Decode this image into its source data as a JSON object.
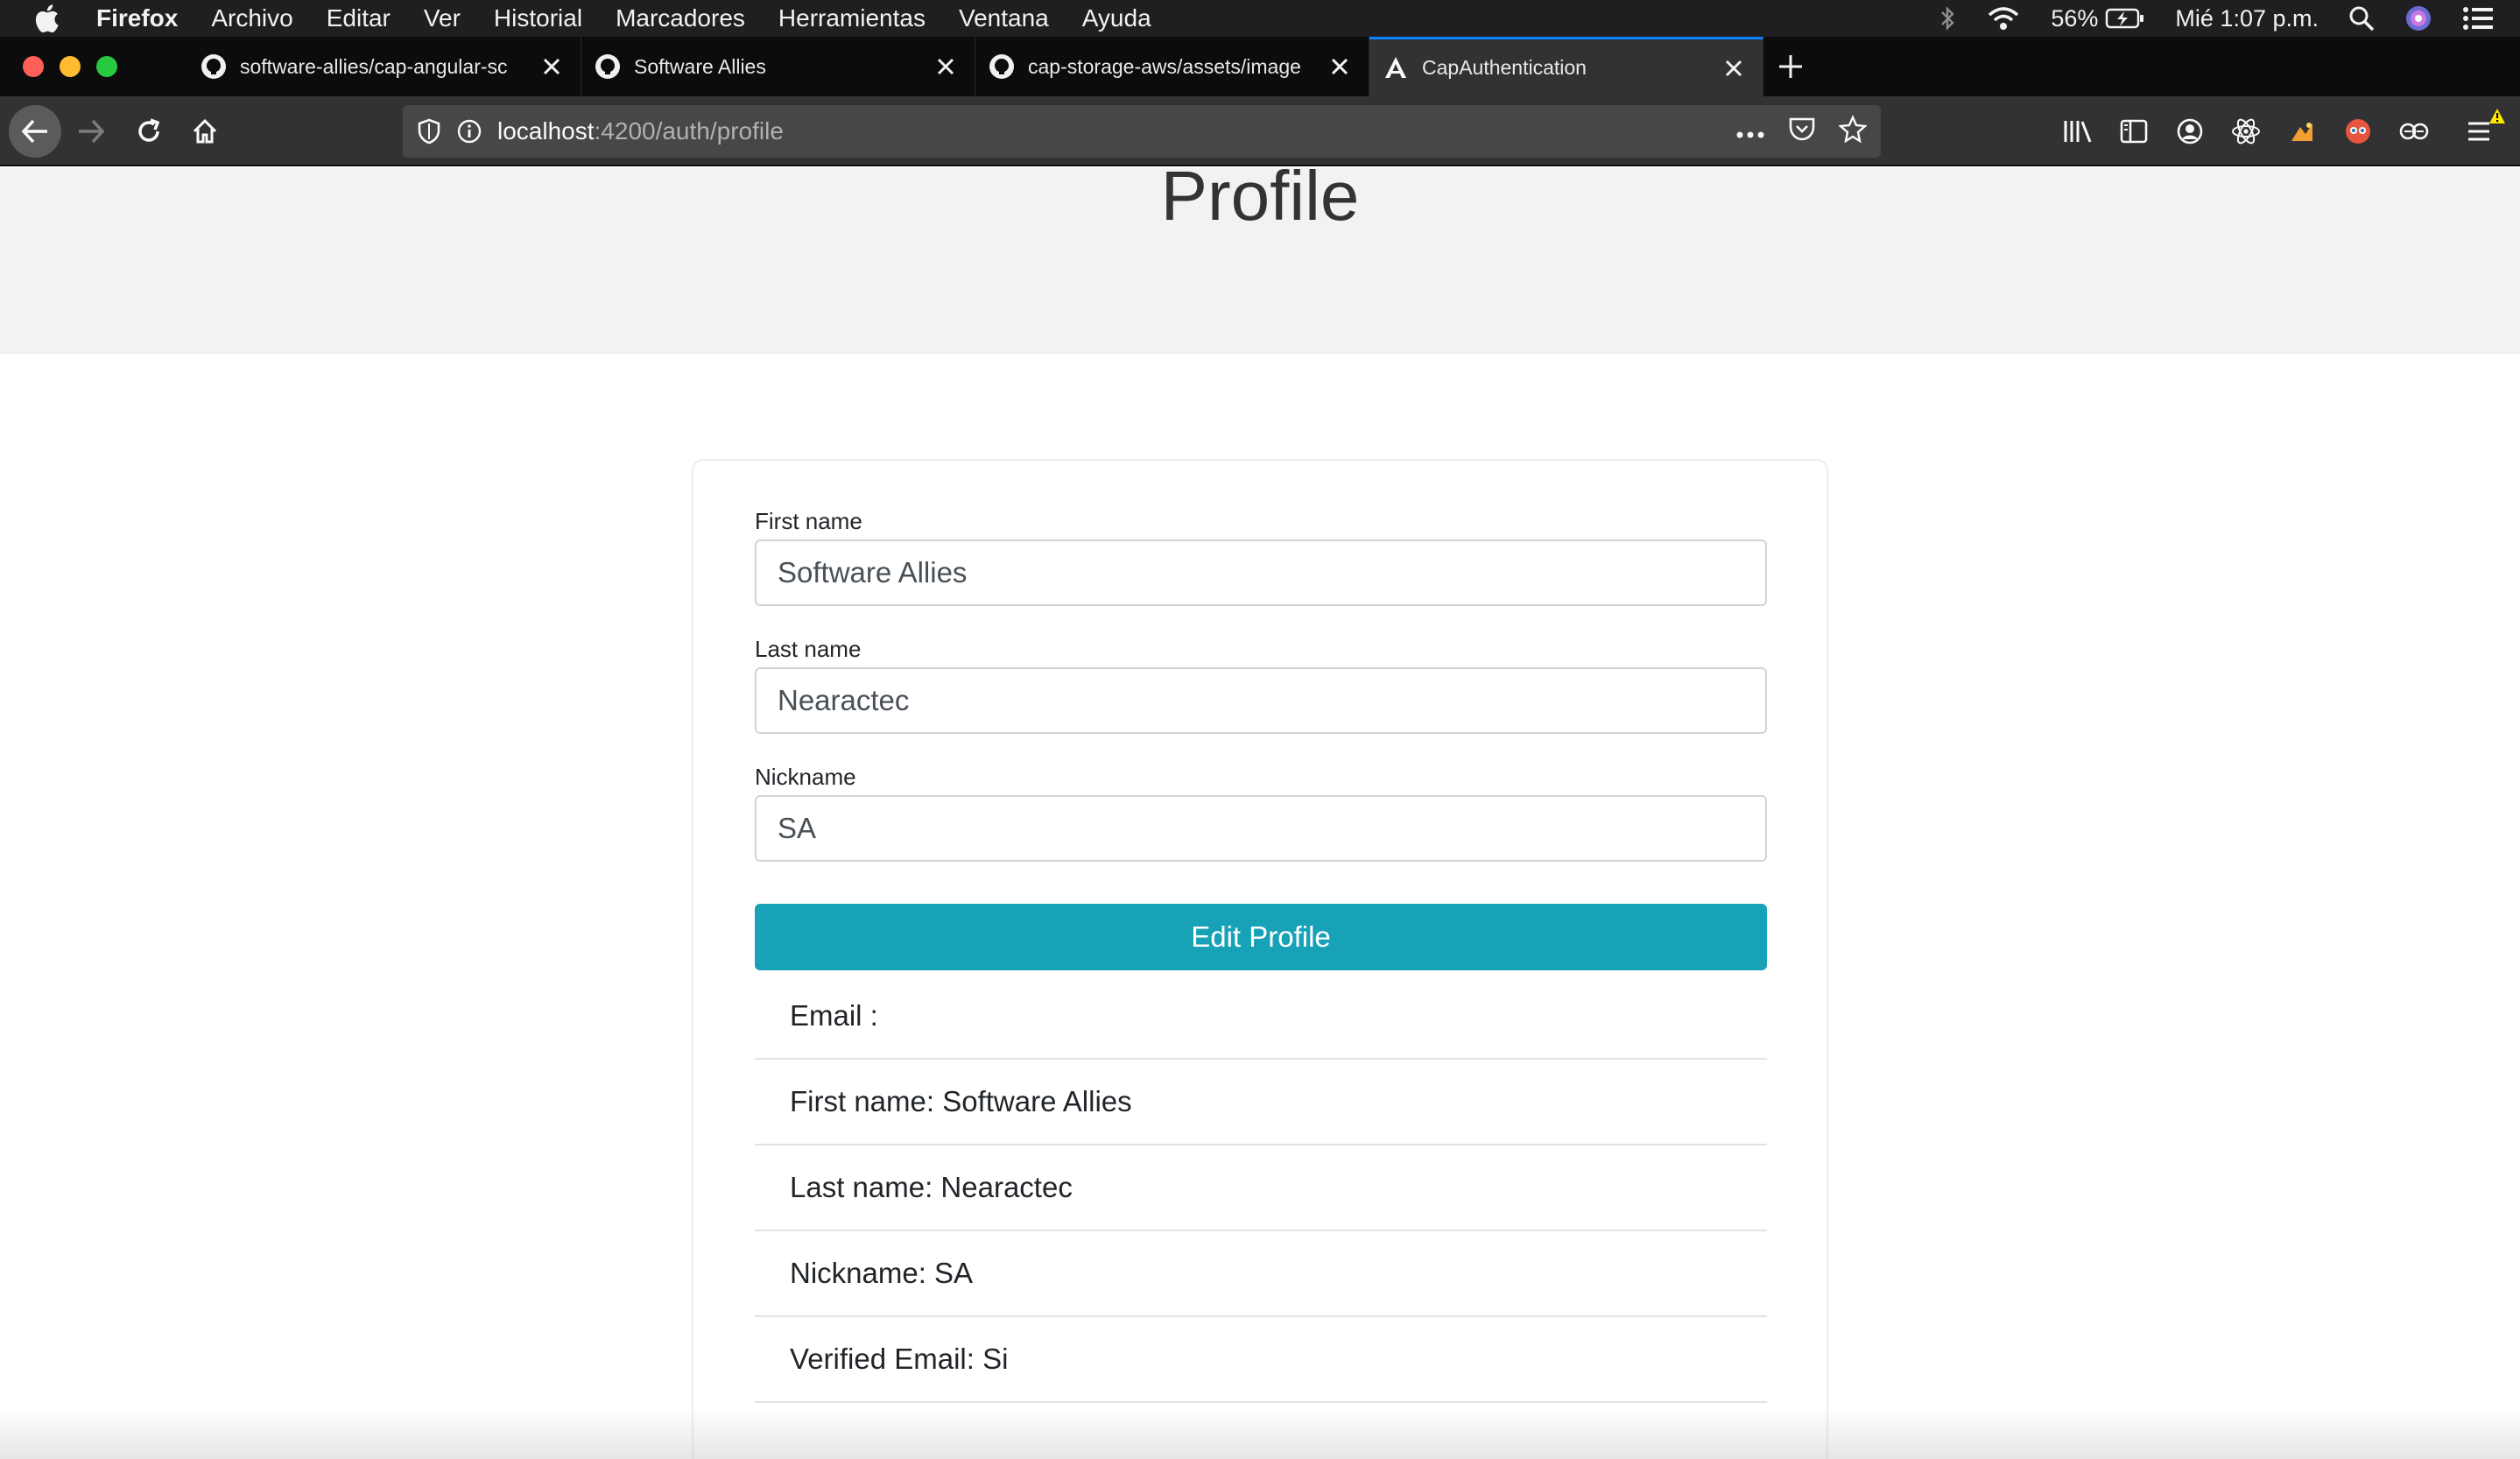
{
  "menubar": {
    "app_name": "Firefox",
    "items": [
      "Archivo",
      "Editar",
      "Ver",
      "Historial",
      "Marcadores",
      "Herramientas",
      "Ventana",
      "Ayuda"
    ],
    "battery": "56%",
    "clock": "Mié 1:07 p.m."
  },
  "tabs": [
    {
      "title": "software-allies/cap-angular-sc",
      "favicon": "github-icon",
      "active": false
    },
    {
      "title": "Software Allies",
      "favicon": "github-icon",
      "active": false
    },
    {
      "title": "cap-storage-aws/assets/image",
      "favicon": "github-icon",
      "active": false
    },
    {
      "title": "CapAuthentication",
      "favicon": "angular-icon",
      "active": true
    }
  ],
  "navbar": {
    "url_host": "localhost",
    "url_rest": ":4200/auth/profile"
  },
  "page": {
    "title": "Profile",
    "form": {
      "first_name_label": "First name",
      "first_name_value": "Software Allies",
      "last_name_label": "Last name",
      "last_name_value": "Nearactec",
      "nickname_label": "Nickname",
      "nickname_value": "SA",
      "edit_button": "Edit Profile"
    },
    "info": [
      "Email :",
      "First name: Software Allies",
      "Last name: Nearactec",
      "Nickname: SA",
      "Verified Email: Si"
    ]
  },
  "colors": {
    "accent": "#17a2b8",
    "active_tab_indicator": "#0a84ff"
  }
}
